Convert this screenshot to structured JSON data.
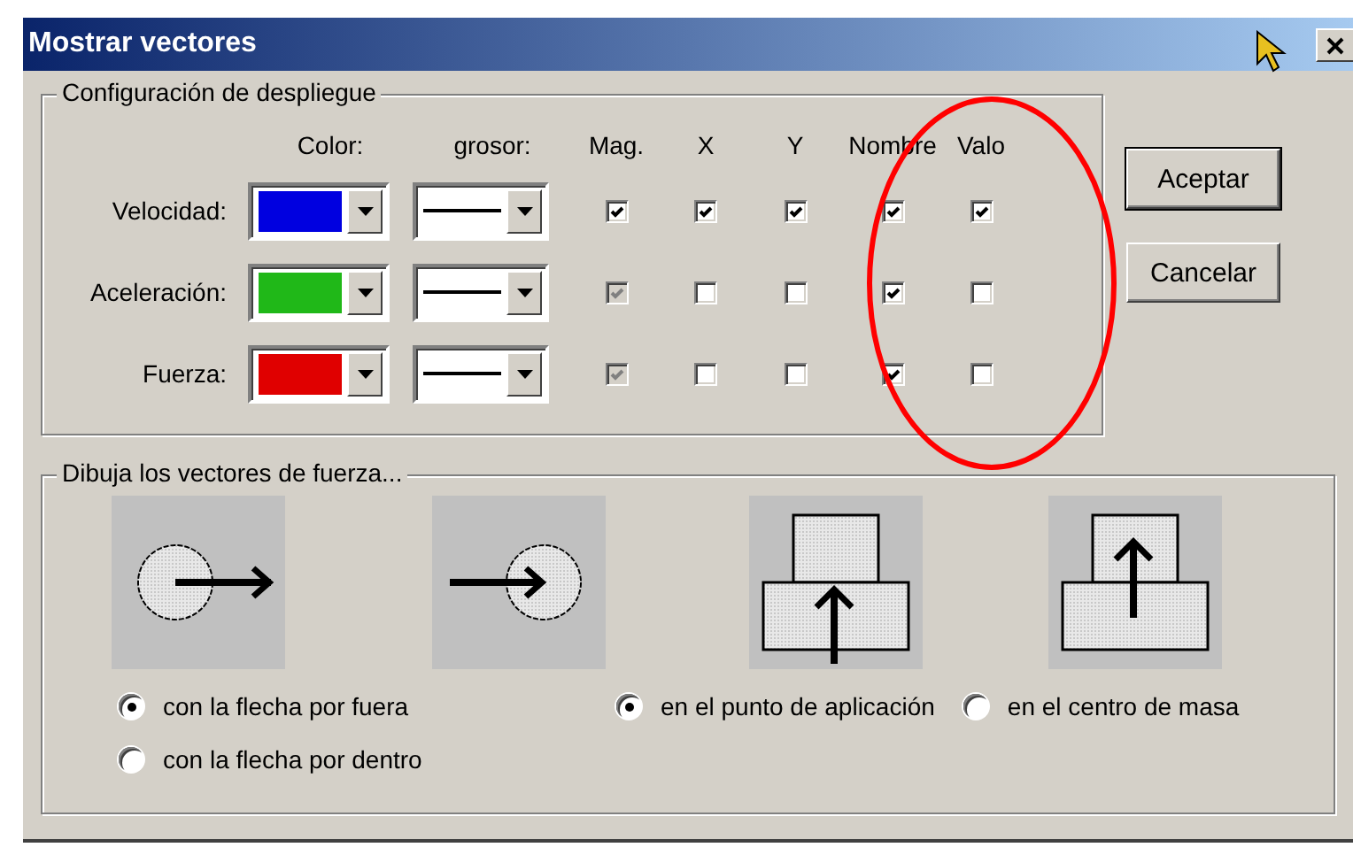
{
  "window": {
    "title": "Mostrar vectores"
  },
  "config": {
    "title": "Configuración de despliegue",
    "columns": [
      "Color:",
      "grosor:",
      "Mag.",
      "X",
      "Y",
      "Nombre",
      "Valo"
    ],
    "rows": [
      {
        "label": "Velocidad:",
        "color": "#0000e0",
        "checks": [
          {
            "checked": true,
            "disabled": false
          },
          {
            "checked": true,
            "disabled": false
          },
          {
            "checked": true,
            "disabled": false
          },
          {
            "checked": true,
            "disabled": false
          },
          {
            "checked": true,
            "disabled": false
          }
        ]
      },
      {
        "label": "Aceleración:",
        "color": "#20b818",
        "checks": [
          {
            "checked": true,
            "disabled": true
          },
          {
            "checked": false,
            "disabled": false
          },
          {
            "checked": false,
            "disabled": false
          },
          {
            "checked": true,
            "disabled": false
          },
          {
            "checked": false,
            "disabled": false
          }
        ]
      },
      {
        "label": "Fuerza:",
        "color": "#e00000",
        "checks": [
          {
            "checked": true,
            "disabled": true
          },
          {
            "checked": false,
            "disabled": false
          },
          {
            "checked": false,
            "disabled": false
          },
          {
            "checked": true,
            "disabled": false
          },
          {
            "checked": false,
            "disabled": false
          }
        ]
      }
    ]
  },
  "buttons": [
    {
      "label": "Aceptar",
      "default": true
    },
    {
      "label": "Cancelar",
      "default": false
    }
  ],
  "vectors": {
    "title": "Dibuja los vectores de fuerza...",
    "illustrations": [
      {
        "kind": "ball-outside"
      },
      {
        "kind": "ball-inside"
      },
      {
        "kind": "block-application"
      },
      {
        "kind": "block-center"
      }
    ],
    "arrow_options": [
      {
        "label": "con la flecha por fuera",
        "selected": true
      },
      {
        "label": "con la flecha por dentro",
        "selected": false
      }
    ],
    "point_options": [
      {
        "label": "en el punto de aplicación",
        "selected": true
      },
      {
        "label": "en el centro de masa",
        "selected": false
      }
    ]
  },
  "annotation": {
    "kind": "ellipse"
  }
}
